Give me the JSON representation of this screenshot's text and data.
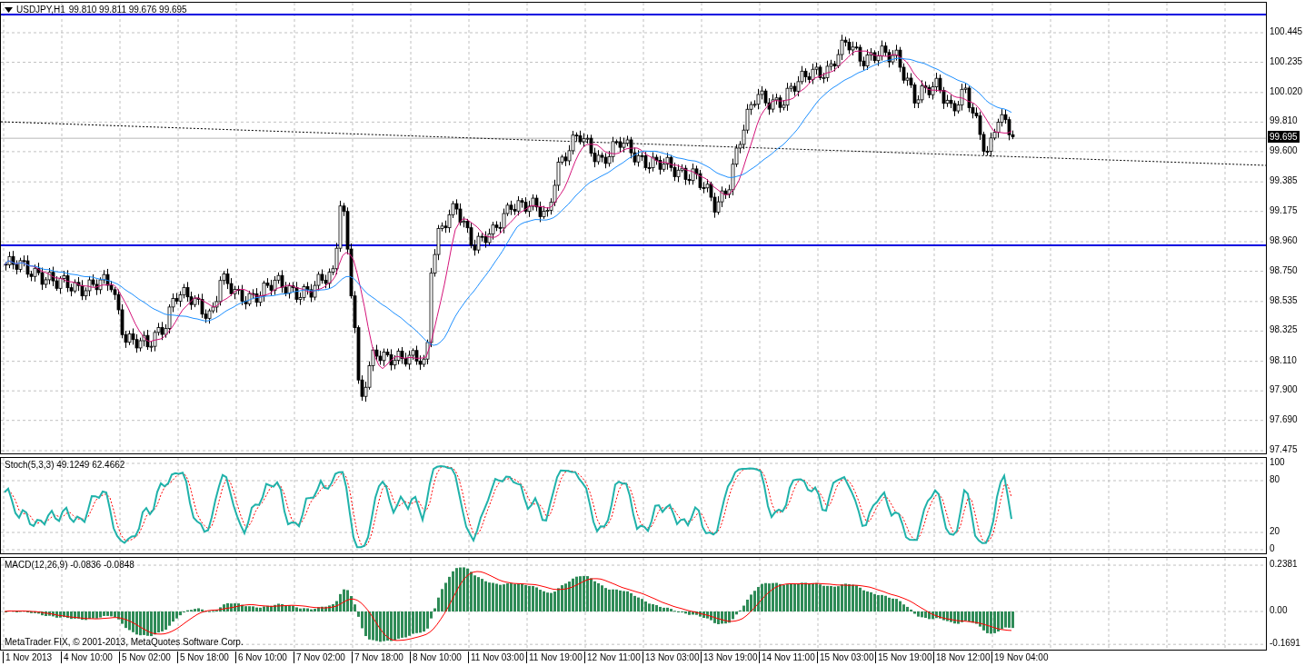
{
  "window": {
    "symbol": "USDJPY,H1",
    "ohlc": "99.810 99.811 99.676 99.695"
  },
  "price_axis": {
    "ticks": [
      "100.445",
      "100.235",
      "100.020",
      "99.810",
      "99.600",
      "99.385",
      "99.175",
      "98.960",
      "98.750",
      "98.535",
      "98.325",
      "98.110",
      "97.900",
      "97.690",
      "97.475"
    ],
    "current_price": "99.695"
  },
  "stochastic": {
    "label": "Stoch(5,3,3) 49.1249 62.4662",
    "ticks": [
      "100",
      "80",
      "20",
      "0"
    ]
  },
  "macd": {
    "label": "MACD(12,26,9) -0.0836 -0.0848",
    "ticks": [
      "0.2381",
      "0.00",
      "-0.1691"
    ]
  },
  "copyright": "MetaTrader FIX, © 2001-2013, MetaQuotes Software Corp.",
  "time_axis": [
    "1 Nov 2013",
    "4 Nov 10:00",
    "5 Nov 02:00",
    "5 Nov 18:00",
    "6 Nov 10:00",
    "7 Nov 02:00",
    "7 Nov 18:00",
    "8 Nov 10:00",
    "11 Nov 03:00",
    "11 Nov 19:00",
    "12 Nov 11:00",
    "13 Nov 03:00",
    "13 Nov 19:00",
    "14 Nov 11:00",
    "15 Nov 03:00",
    "15 Nov 19:00",
    "18 Nov 12:00",
    "19 Nov 04:00"
  ]
}
